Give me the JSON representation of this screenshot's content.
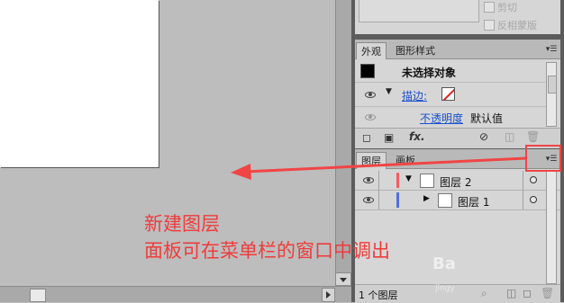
{
  "mask_panel": {
    "clip_label": "剪切",
    "invert_mask_label": "反相蒙版"
  },
  "appearance_panel": {
    "tabs": [
      "外观",
      "图形样式"
    ],
    "selection_text": "未选择对象",
    "stroke_label": "描边:",
    "opacity_label": "不透明度",
    "opacity_value": "默认值",
    "fx_label": "fx."
  },
  "layers_panel": {
    "tabs": [
      "图层",
      "画板"
    ],
    "layers": [
      {
        "name": "图层 2",
        "expanded": true,
        "color": "#ff5a5a"
      },
      {
        "name": "图层 1",
        "expanded": false,
        "color": "#4f6fe0"
      }
    ],
    "status_text": "1 个图层"
  },
  "annotation": {
    "line1": "新建图层",
    "line2": "面板可在菜单栏的窗口中调出",
    "color": "#f03b3b"
  },
  "watermark": {
    "main": "Ba",
    "sub": "jingy"
  }
}
